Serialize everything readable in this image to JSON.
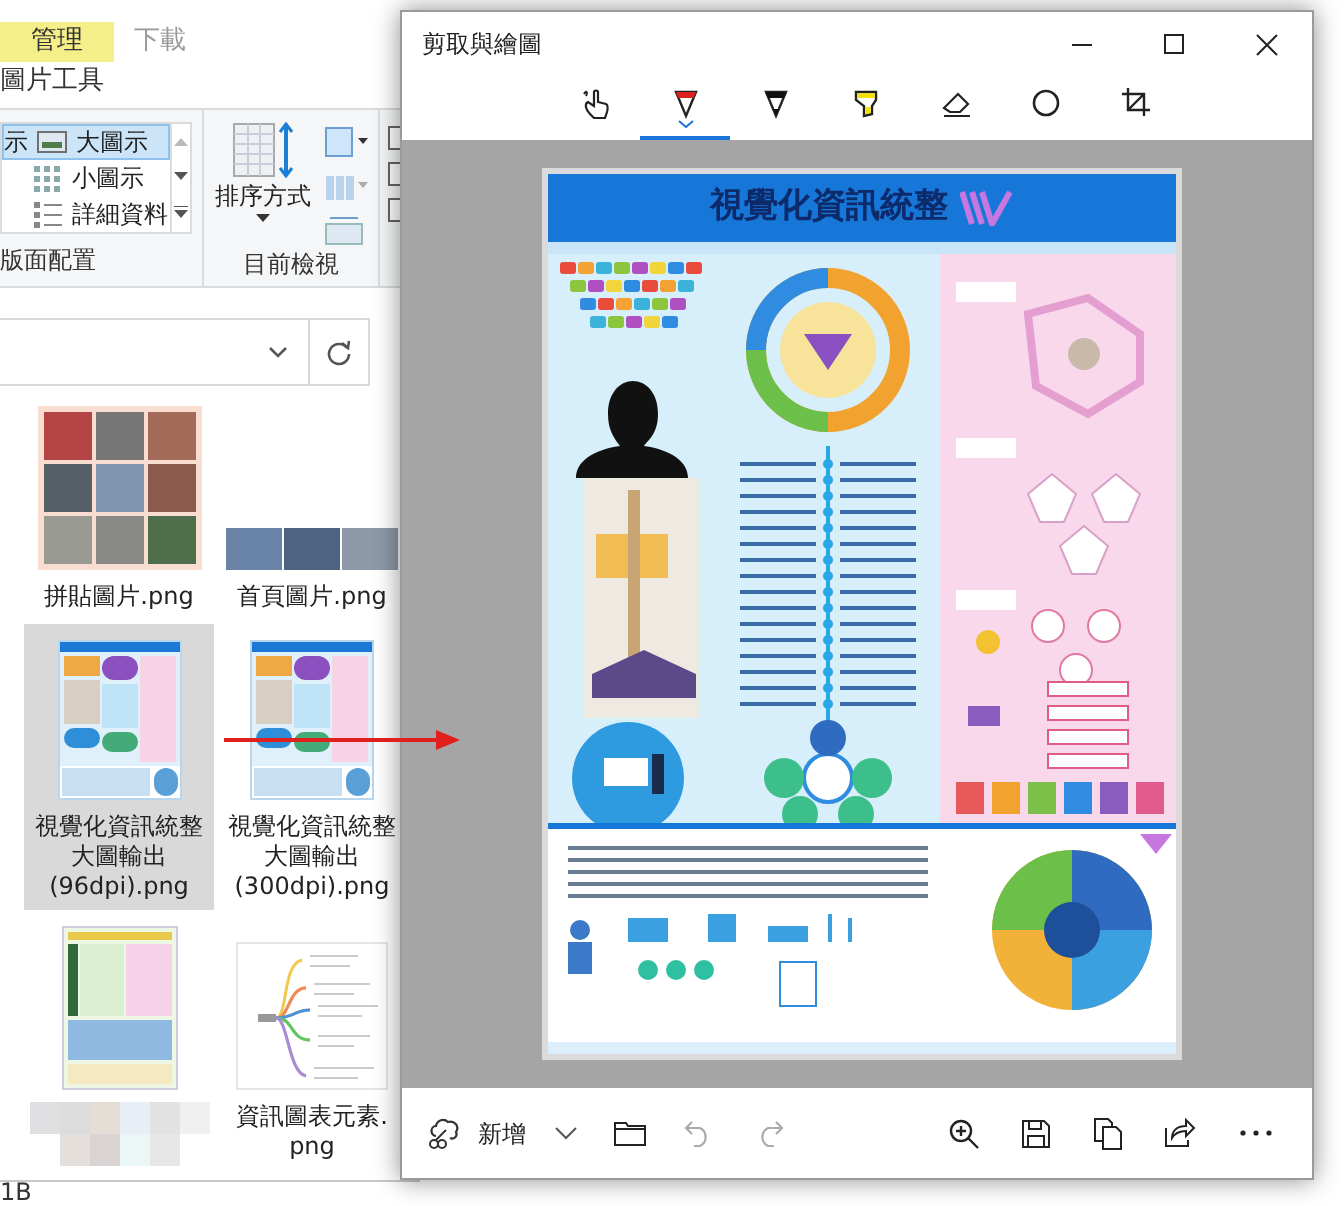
{
  "explorer": {
    "ribbon_tabs": [
      {
        "label": "管理",
        "selected": true
      },
      {
        "label": "下載",
        "selected": false
      }
    ],
    "context_label": "圖片工具",
    "layout_partial": "示",
    "layout_options": [
      {
        "label": "大圖示",
        "selected": true
      },
      {
        "label": "小圖示",
        "selected": false
      },
      {
        "label": "詳細資料",
        "selected": false
      }
    ],
    "sort_button": "排序方式",
    "group_labels": [
      "版面配置",
      "目前檢視"
    ],
    "files": [
      {
        "kind": "collage",
        "name": [
          "拼貼圖片.png"
        ],
        "selected": false
      },
      {
        "kind": "banner",
        "name": [
          "首頁圖片.png"
        ],
        "selected": false
      },
      {
        "kind": "infographic",
        "name": [
          "視覺化資訊統整",
          "大圖輸出",
          "(96dpi).png"
        ],
        "selected": true
      },
      {
        "kind": "infographic",
        "name": [
          "視覺化資訊統整",
          "大圖輸出",
          "(300dpi).png"
        ],
        "selected": false
      },
      {
        "kind": "poster",
        "selected": false
      },
      {
        "kind": "mindmap",
        "name": [
          "資訊圖表元素.",
          "png"
        ],
        "selected": false
      }
    ],
    "status": "1B"
  },
  "snip": {
    "title": "剪取與繪圖",
    "tools": [
      {
        "kind": "touch",
        "selected": false
      },
      {
        "kind": "ballpoint",
        "selected": true
      },
      {
        "kind": "pencil",
        "selected": false
      },
      {
        "kind": "highlighter",
        "selected": false
      },
      {
        "kind": "eraser",
        "selected": false
      },
      {
        "kind": "ruler",
        "selected": false
      },
      {
        "kind": "crop",
        "selected": false
      }
    ],
    "image_title": "視覺化資訊統整",
    "new_button": "新增"
  }
}
